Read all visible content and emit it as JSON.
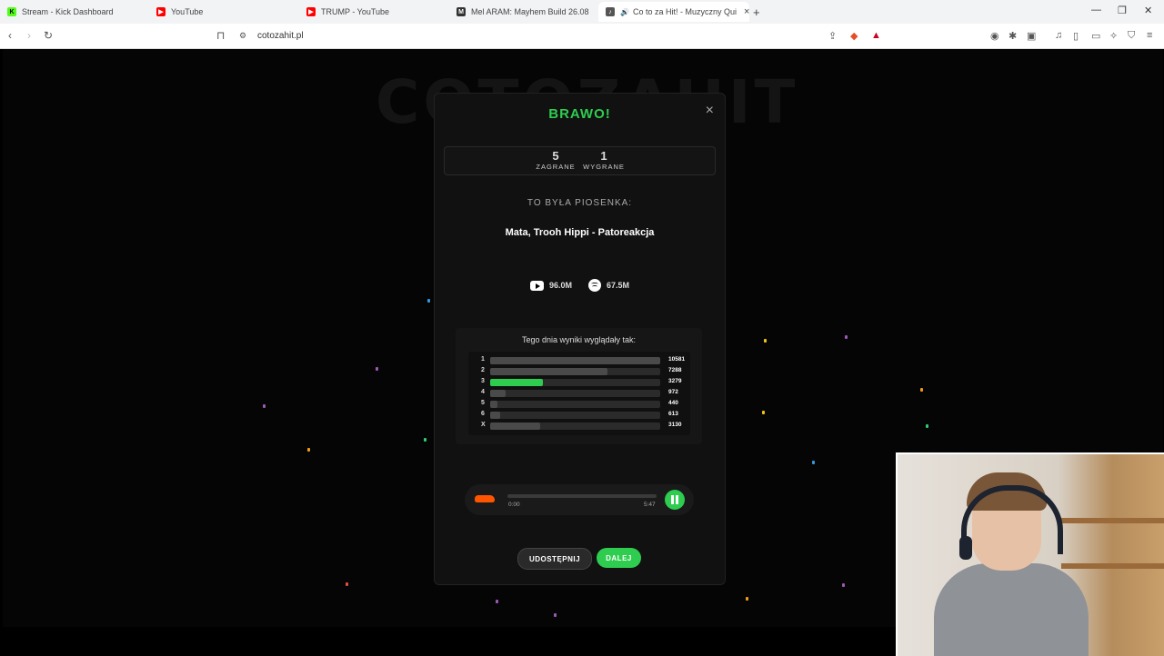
{
  "browser": {
    "tabs": [
      {
        "title": "Stream - Kick Dashboard",
        "favicon_color": "#53fc18",
        "favicon_letter": "K"
      },
      {
        "title": "YouTube",
        "favicon_color": "#ff0000",
        "favicon_letter": "▶"
      },
      {
        "title": "TRUMP - YouTube",
        "favicon_color": "#ff0000",
        "favicon_letter": "▶"
      },
      {
        "title": "Mel ARAM: Mayhem Build 26.08 - A",
        "favicon_color": "#333333",
        "favicon_letter": "M"
      },
      {
        "title": "Co to za Hit! - Muzyczny Qui",
        "favicon_color": "#555555",
        "favicon_letter": "♪",
        "active": true
      }
    ],
    "new_tab": "+",
    "url": "cotozahit.pl"
  },
  "page": {
    "bg_title": "COTOZAHIT"
  },
  "modal": {
    "close": "×",
    "title": "BRAWO!",
    "stats": [
      {
        "value": "5",
        "label": "ZAGRANE"
      },
      {
        "value": "1",
        "label": "WYGRANE"
      }
    ],
    "was_song_label": "TO BYŁA PIOSENKA:",
    "song": "Mata, Trooh Hippi - Patoreakcja",
    "youtube_views": "96.0M",
    "spotify_plays": "67.5M",
    "results_title": "Tego dnia wyniki wyglądały tak:",
    "results": [
      {
        "key": "1",
        "value": 10581,
        "label": "10581"
      },
      {
        "key": "2",
        "value": 7288,
        "label": "7288"
      },
      {
        "key": "3",
        "value": 3279,
        "label": "3279",
        "highlight": true
      },
      {
        "key": "4",
        "value": 972,
        "label": "972"
      },
      {
        "key": "5",
        "value": 440,
        "label": "440"
      },
      {
        "key": "6",
        "value": 613,
        "label": "613"
      },
      {
        "key": "X",
        "value": 3130,
        "label": "3130"
      }
    ],
    "player": {
      "time_current": "0:00",
      "time_total": "5:47",
      "progress_fraction": 0.0
    },
    "share_label": "UDOSTĘPNIJ",
    "next_label": "DALEJ"
  },
  "colors": {
    "accent": "#2ecc4f",
    "soundcloud": "#ff5500"
  }
}
